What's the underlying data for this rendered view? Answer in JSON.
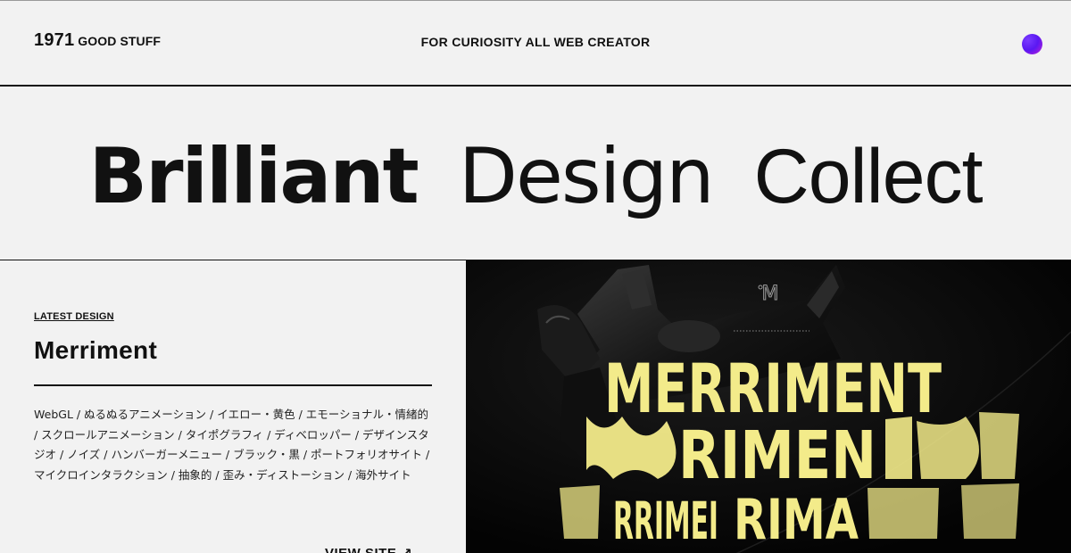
{
  "header": {
    "logo_year": "1971",
    "logo_name": "GOOD STUFF",
    "tagline": "FOR CURIOSITY ALL WEB CREATOR"
  },
  "hero": {
    "word1": "Brilliant",
    "word2": "Design",
    "word3": "Collect"
  },
  "latest": {
    "section_label": "LATEST DESIGN",
    "title": "Merriment",
    "tags": "WebGL / ぬるぬるアニメーション / イエロー・黄色 / エモーショナル・情緒的 / スクロールアニメーション / タイポグラフィ / ディベロッパー / デザインスタジオ / ノイズ / ハンバーガーメニュー / ブラック・黒 / ポートフォリオサイト / マイクロインタラクション / 抽象的 / 歪み・ディストーション / 海外サイト",
    "view_site_label": "VIEW SITE",
    "view_site_icon": "arrow-up-right-icon"
  },
  "preview": {
    "main_word": "MERRIMENT",
    "row2_word": "RIMEN",
    "row3_left": "RRIMEI",
    "row3_mid": "RIMA",
    "monogram": "M",
    "accent": "#f3eb8a"
  },
  "colors": {
    "background": "#f2f2f2",
    "text": "#111111",
    "orb_start": "#5a18f2",
    "orb_end": "#c21fd8"
  }
}
